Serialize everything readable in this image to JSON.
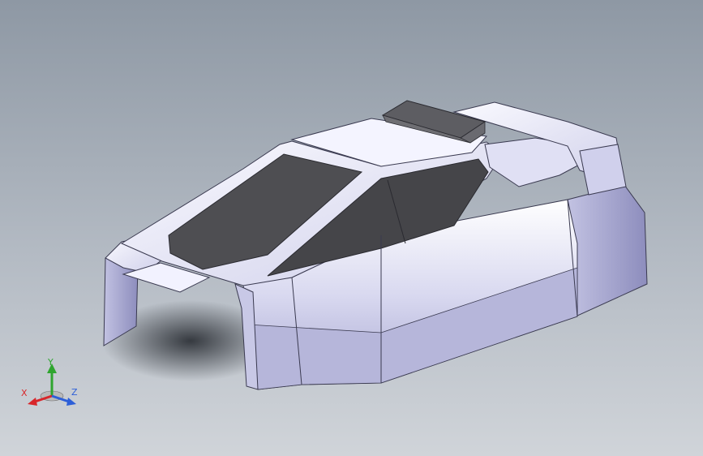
{
  "triad": {
    "x_label": "X",
    "y_label": "Y",
    "z_label": "Z",
    "x_color": "#d8262a",
    "y_color": "#2fa52f",
    "z_color": "#2d5fd8"
  },
  "model": {
    "description_icon": "rc-car-body-shell-3d-model",
    "face_color": "#dcdcf2",
    "shade_color": "#9c9cc6",
    "window_color": "#4a4a4e",
    "spoiler_color": "#5a5a5e"
  }
}
